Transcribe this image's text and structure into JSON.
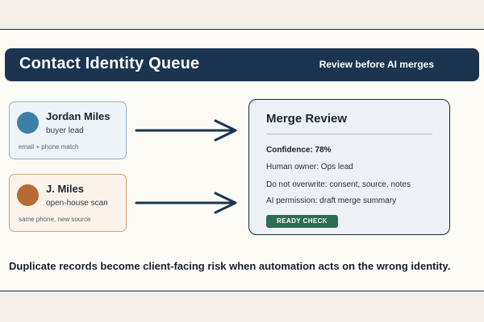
{
  "header": {
    "title": "Contact Identity Queue",
    "subtitle": "Review before AI merges"
  },
  "contacts": [
    {
      "name": "Jordan Miles",
      "role": "buyer lead",
      "note": "email + phone match",
      "avatar_color": "#3e7fa9"
    },
    {
      "name": "J. Miles",
      "role": "open-house scan",
      "note": "same phone, new source",
      "avatar_color": "#b86a33"
    }
  ],
  "review": {
    "title": "Merge Review",
    "confidence": "Confidence: 78%",
    "owner": "Human owner: Ops lead",
    "overwrite": "Do not overwrite: consent, source, notes",
    "permission": "AI permission: draft merge summary",
    "badge": "READY CHECK"
  },
  "footer": {
    "text": "Duplicate records become client-facing risk when automation acts on the wrong identity."
  },
  "colors": {
    "header_bg": "#1b3551",
    "badge_bg": "#2e6b50",
    "arrow": "#1b3551"
  }
}
